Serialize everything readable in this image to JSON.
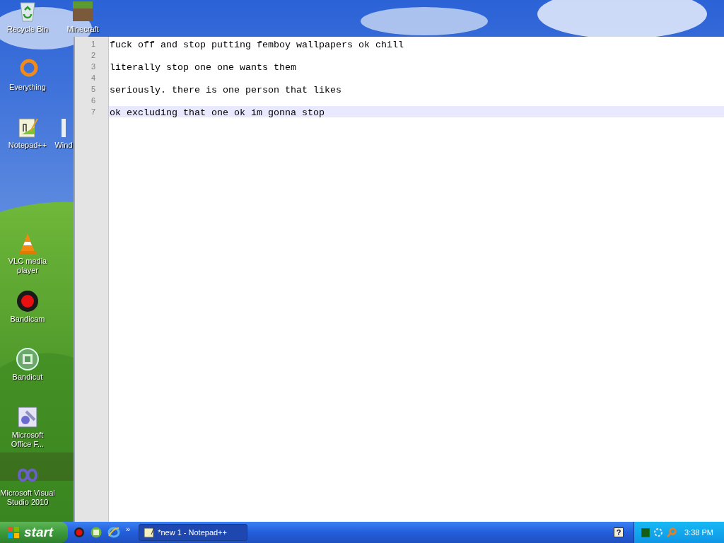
{
  "desktop_icons": [
    {
      "label": "Recycle Bin"
    },
    {
      "label": "Minecraft"
    },
    {
      "label": "Everything"
    },
    {
      "label": "Notepad++"
    },
    {
      "label": "Wind"
    },
    {
      "label": "VLC media player"
    },
    {
      "label": "Bandicam"
    },
    {
      "label": "Bandicut"
    },
    {
      "label": "Microsoft Office F..."
    },
    {
      "label": "Microsoft Visual Studio 2010"
    }
  ],
  "editor": {
    "lines": [
      {
        "number": "1",
        "text": "fuck off and stop putting femboy wallpapers ok chill",
        "current": false
      },
      {
        "number": "2",
        "current": false
      },
      {
        "number": "3",
        "text": "literally stop one one wants them",
        "current": false
      },
      {
        "number": "4",
        "current": false
      },
      {
        "number": "5",
        "text": "seriously. there is one person that likes",
        "current": false
      },
      {
        "number": "6",
        "current": false
      },
      {
        "number": "7",
        "text": "ok excluding that one ok im gonna stop",
        "current": true
      }
    ]
  },
  "taskbar": {
    "start": "start",
    "chevron": "»",
    "tasks": [
      {
        "label": "*new 1 - Notepad++",
        "selected": true
      }
    ],
    "help": "?",
    "clock": "3:38 PM"
  }
}
